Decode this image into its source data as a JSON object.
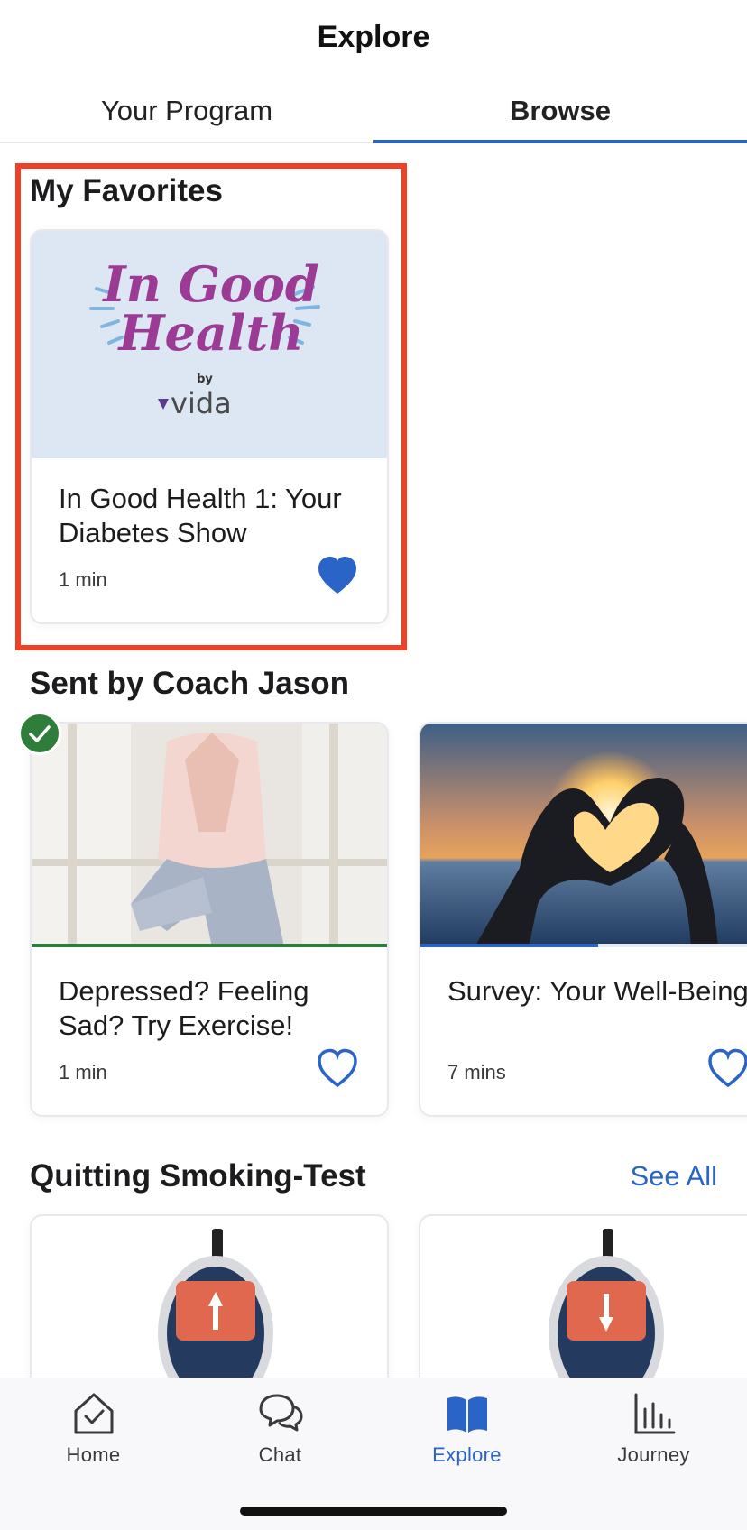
{
  "header": {
    "title": "Explore"
  },
  "tabs": [
    {
      "label": "Your Program",
      "active": false
    },
    {
      "label": "Browse",
      "active": true
    }
  ],
  "favorites": {
    "title": "My Favorites",
    "cards": [
      {
        "image_logo_line1": "In Good",
        "image_logo_line2": "Health",
        "image_logo_by": "by",
        "image_logo_brand": "vida",
        "title": "In Good Health 1: Your Diabetes Show",
        "duration": "1 min",
        "favorited": true
      }
    ]
  },
  "coach": {
    "title": "Sent by Coach Jason",
    "cards": [
      {
        "image": "woman-yoga-tree-pose-photo",
        "title": "Depressed? Feeling Sad? Try Exercise!",
        "duration": "1 min",
        "favorited": false,
        "completed": true,
        "progress": 1.0
      },
      {
        "image": "heart-hands-sunset-photo",
        "title": "Survey: Your Well-Being",
        "duration": "7 mins",
        "favorited": false,
        "completed": false,
        "progress": 0.5
      }
    ]
  },
  "smoking": {
    "title": "Quitting Smoking-Test",
    "see_all": "See All",
    "cards": [
      {
        "image": "glucose-meter-arrow-up"
      },
      {
        "image": "glucose-meter-arrow-down"
      }
    ]
  },
  "bottom_nav": [
    {
      "label": "Home",
      "icon": "home-check-icon",
      "active": false
    },
    {
      "label": "Chat",
      "icon": "chat-bubbles-icon",
      "active": false
    },
    {
      "label": "Explore",
      "icon": "open-book-icon",
      "active": true
    },
    {
      "label": "Journey",
      "icon": "bar-chart-icon",
      "active": false
    }
  ],
  "colors": {
    "accent": "#2a64c7",
    "highlight": "#ee4126",
    "success": "#2f7d3a",
    "logo_purple": "#9b3b95",
    "logo_bg": "#dde7f4"
  }
}
